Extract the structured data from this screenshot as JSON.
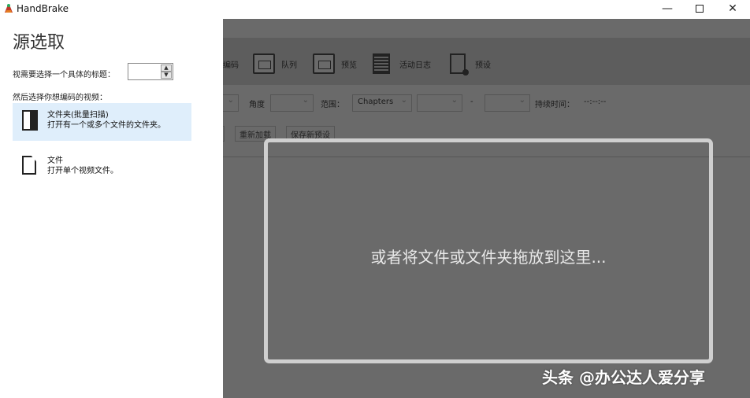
{
  "window": {
    "title": "HandBrake",
    "min_glyph": "—",
    "close_glyph": "✕"
  },
  "source": {
    "heading": "源选取",
    "title_label": "视需要选择一个具体的标题：",
    "title_value": "",
    "video_label": "然后选择你想编码的视频：",
    "options": [
      {
        "title": "文件夹(批量扫描)",
        "desc": "打开有一个或多个文件的文件夹。",
        "icon": "folder-icon",
        "selected": true
      },
      {
        "title": "文件",
        "desc": "打开单个视频文件。",
        "icon": "file-icon",
        "selected": false
      }
    ]
  },
  "toolbar": {
    "encode": "编码",
    "queue": "队列",
    "preview": "预览",
    "activity_log": "活动日志",
    "presets": "预设"
  },
  "source_row": {
    "angle": "角度",
    "range": "范围：",
    "range_value": "Chapters",
    "dash": "-",
    "duration": "持续时间：",
    "duration_value": "--:--:--"
  },
  "buttons": {
    "reload": "重新加载",
    "save_preset": "保存新预设"
  },
  "dropzone": {
    "text": "或者将文件或文件夹拖放到这里..."
  },
  "watermark": "头条 @办公达人爱分享"
}
